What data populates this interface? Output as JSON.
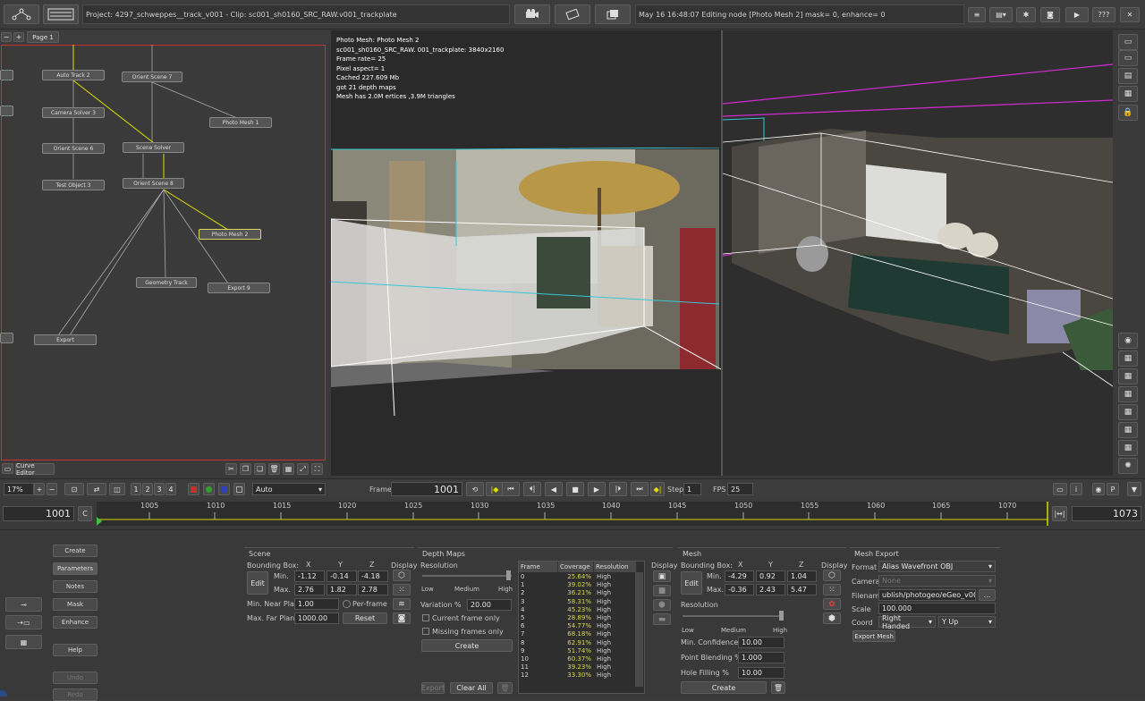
{
  "title_bar": "Project: 4297_schweppes__track_v001 - Clip: sc001_sh0160_SRC_RAW.v001_trackplate",
  "status_bar": "May 16 16:48:07 Editing node [Photo Mesh 2] mask= 0, enhance= 0",
  "help_btn": "???",
  "page_tab": "Page 1",
  "curve_editor": "Curve Editor",
  "zoom_value": "17%",
  "zoom_mode": "Auto",
  "layout_nums": [
    "1",
    "2",
    "3",
    "4"
  ],
  "nodes": {
    "auto_track": "Auto Track 2",
    "orient7": "Orient Scene 7",
    "photo_mesh1": "Photo Mesh 1",
    "camera_solver": "Camera Solver 3",
    "scene_solver": "Scene Solver",
    "orient6": "Orient Scene 6",
    "test_object": "Test Object 3",
    "orient8": "Orient Scene 8",
    "photo_mesh2": "Photo Mesh 2",
    "geometry_track": "Geometry Track",
    "export9": "Export 9",
    "export": "Export"
  },
  "viewer_info": [
    "Photo Mesh: Photo Mesh 2",
    "sc001_sh0160_SRC_RAW.  001_trackplate: 3840x2160",
    "Frame rate= 25",
    "Pixel aspect= 1",
    "Cached 227.609 Mb",
    " got 21 depth maps",
    "Mesh has 2.0M   ertices ,3.9M triangles"
  ],
  "transport": {
    "frame_label": "Frame",
    "frame_value": "1001",
    "step_label": "Step",
    "step_value": "1",
    "fps_label": "FPS",
    "fps_value": "25"
  },
  "timeline": {
    "start": "1001",
    "end": "1073",
    "c_btn": "C",
    "ticks": [
      "1005",
      "1010",
      "1015",
      "1020",
      "1025",
      "1030",
      "1035",
      "1040",
      "1045",
      "1050",
      "1055",
      "1060",
      "1065",
      "1070"
    ]
  },
  "tabs": [
    "Create",
    "Parameters",
    "Notes",
    "Mask",
    "Enhance",
    "Help",
    "Undo",
    "Redo"
  ],
  "scene": {
    "title": "Scene",
    "bbox": "Bounding Box:",
    "x": "X",
    "y": "Y",
    "z": "Z",
    "display": "Display",
    "edit": "Edit",
    "min": "Min.",
    "max": "Max.",
    "min_x": "-1.12",
    "min_y": "-0.14",
    "min_z": "-4.18",
    "max_x": "2.76",
    "max_y": "1.82",
    "max_z": "2.78",
    "near_label": "Min. Near Plane",
    "near_value": "1.00",
    "per_frame": "Per-frame",
    "far_label": "Max. Far Plane",
    "far_value": "1000.00",
    "reset": "Reset"
  },
  "depth": {
    "title": "Depth Maps",
    "resolution": "Resolution",
    "low": "Low",
    "medium": "Medium",
    "high": "High",
    "variation_label": "Variation %",
    "variation_value": "20.00",
    "current_frame": "Current frame only",
    "missing_frames": "Missing frames only",
    "create": "Create",
    "export": "Export",
    "clear_all": "Clear All",
    "col_frame": "Frame",
    "col_coverage": "Coverage",
    "col_resolution": "Resolution",
    "display": "Display",
    "rows": [
      {
        "f": "0",
        "c": "25.64%",
        "r": "High"
      },
      {
        "f": "1",
        "c": "39.02%",
        "r": "High"
      },
      {
        "f": "2",
        "c": "36.21%",
        "r": "High"
      },
      {
        "f": "3",
        "c": "58.31%",
        "r": "High"
      },
      {
        "f": "4",
        "c": "45.23%",
        "r": "High"
      },
      {
        "f": "5",
        "c": "28.89%",
        "r": "High"
      },
      {
        "f": "6",
        "c": "54.77%",
        "r": "High"
      },
      {
        "f": "7",
        "c": "68.18%",
        "r": "High"
      },
      {
        "f": "8",
        "c": "62.91%",
        "r": "High"
      },
      {
        "f": "9",
        "c": "51.74%",
        "r": "High"
      },
      {
        "f": "10",
        "c": "60.37%",
        "r": "High"
      },
      {
        "f": "11",
        "c": "39.23%",
        "r": "High"
      },
      {
        "f": "12",
        "c": "33.30%",
        "r": "High"
      }
    ]
  },
  "mesh": {
    "title": "Mesh",
    "bbox": "Bounding Box:",
    "x": "X",
    "y": "Y",
    "z": "Z",
    "display": "Display",
    "edit": "Edit",
    "min": "Min.",
    "max": "Max.",
    "min_x": "-4.29",
    "min_y": "0.92",
    "min_z": "1.04",
    "max_x": "-0.36",
    "max_y": "2.43",
    "max_z": "5.47",
    "resolution": "Resolution",
    "low": "Low",
    "medium": "Medium",
    "high": "High",
    "conf_label": "Min. Confidence %",
    "conf_value": "10.00",
    "blend_label": "Point Blending %",
    "blend_value": "1.000",
    "hole_label": "Hole Filling %",
    "hole_value": "10.00",
    "create": "Create"
  },
  "mesh_export": {
    "title": "Mesh Export",
    "format_label": "Format",
    "format_value": "Alias Wavefront OBJ",
    "cameras_label": "Cameras",
    "cameras_value": "None",
    "filename_label": "Filename",
    "filename_value": "ublish/photogeo/eGeo_v003.obj",
    "browse": "...",
    "scale_label": "Scale",
    "scale_value": "100.000",
    "coord_label": "Coord",
    "coord_value": "Right Handed",
    "up_value": "Y Up",
    "export_btn": "Export Mesh"
  },
  "colors": {
    "accent_yellow": "#e0e000",
    "bbox_cyan": "#37c6d6",
    "bbox_magenta": "#d22ad2",
    "node_border_red": "#c83232",
    "coverage_text": "#d8d84a"
  }
}
